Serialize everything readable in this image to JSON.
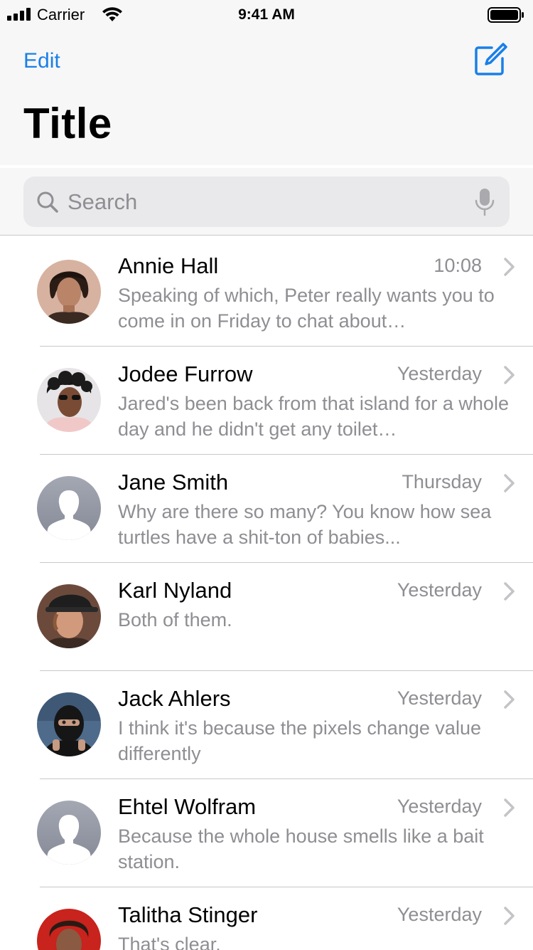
{
  "status_bar": {
    "carrier": "Carrier",
    "time": "9:41 AM",
    "icons": [
      "signal-bars-icon",
      "wifi-icon",
      "battery-icon"
    ]
  },
  "nav": {
    "edit_label": "Edit",
    "compose_icon": "compose-icon",
    "title": "Title"
  },
  "search": {
    "placeholder": "Search",
    "icon": "search-icon",
    "mic_icon": "microphone-icon"
  },
  "colors": {
    "accent": "#1a7fe8",
    "secondary_text": "#8e8e93",
    "separator": "#c8c8cc",
    "header_background": "#f7f7f7",
    "search_background": "#e9e9eb"
  },
  "conversations": [
    {
      "name": "Annie Hall",
      "date": "10:08",
      "preview": "Speaking of which, Peter really wants you to come in on Friday to chat about…",
      "avatar": "photo"
    },
    {
      "name": "Jodee Furrow",
      "date": "Yesterday",
      "preview": "Jared's been back from that island for a whole day and he didn't get any toilet…",
      "avatar": "photo"
    },
    {
      "name": "Jane Smith",
      "date": "Thursday",
      "preview": "Why are there so many? You know how sea turtles have a shit-ton of babies...",
      "avatar": "placeholder"
    },
    {
      "name": "Karl Nyland",
      "date": "Yesterday",
      "preview": "Both of them.",
      "avatar": "photo"
    },
    {
      "name": "Jack Ahlers",
      "date": "Yesterday",
      "preview": "I think it's because the pixels change value differently",
      "avatar": "photo"
    },
    {
      "name": "Ehtel Wolfram",
      "date": "Yesterday",
      "preview": "Because the whole house smells like a bait station.",
      "avatar": "placeholder"
    },
    {
      "name": "Talitha Stinger",
      "date": "Yesterday",
      "preview": "That's clear.",
      "avatar": "photo"
    }
  ]
}
